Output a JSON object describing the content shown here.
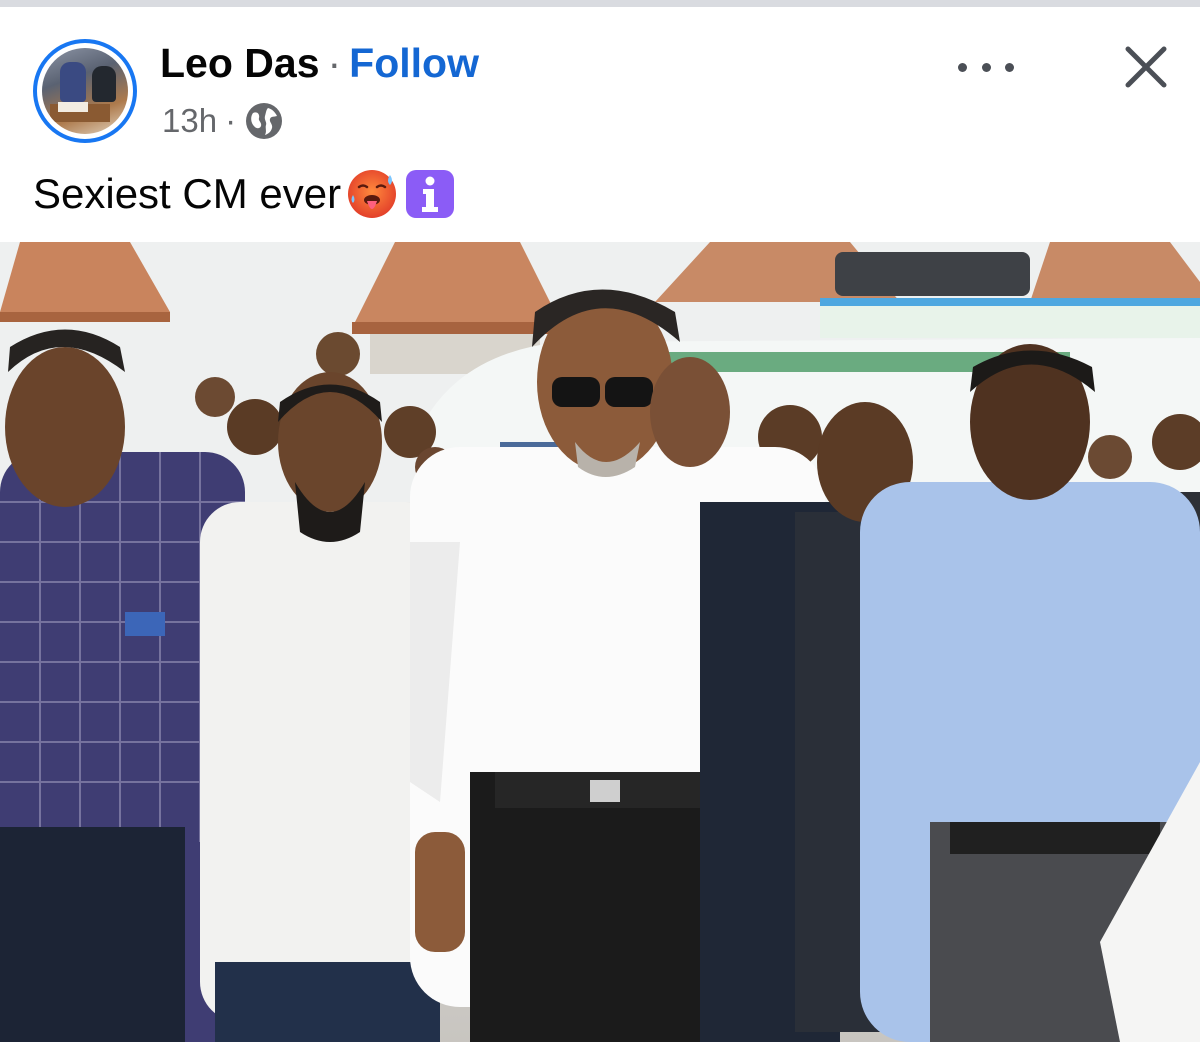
{
  "post": {
    "author_name": "Leo Das",
    "separator": "·",
    "follow_label": "Follow",
    "timestamp": "13h",
    "meta_separator": "·",
    "audience_icon": "globe-icon",
    "caption_text": "Sexiest CM ever",
    "caption_emojis": [
      "hot-face-emoji",
      "information-emoji"
    ]
  },
  "actions": {
    "more_icon": "more-horizontal-icon",
    "close_icon": "close-icon"
  },
  "colors": {
    "accent": "#1467d3",
    "avatar_ring": "#1877f2",
    "secondary_text": "#65676b",
    "primary_text": "#050505"
  }
}
